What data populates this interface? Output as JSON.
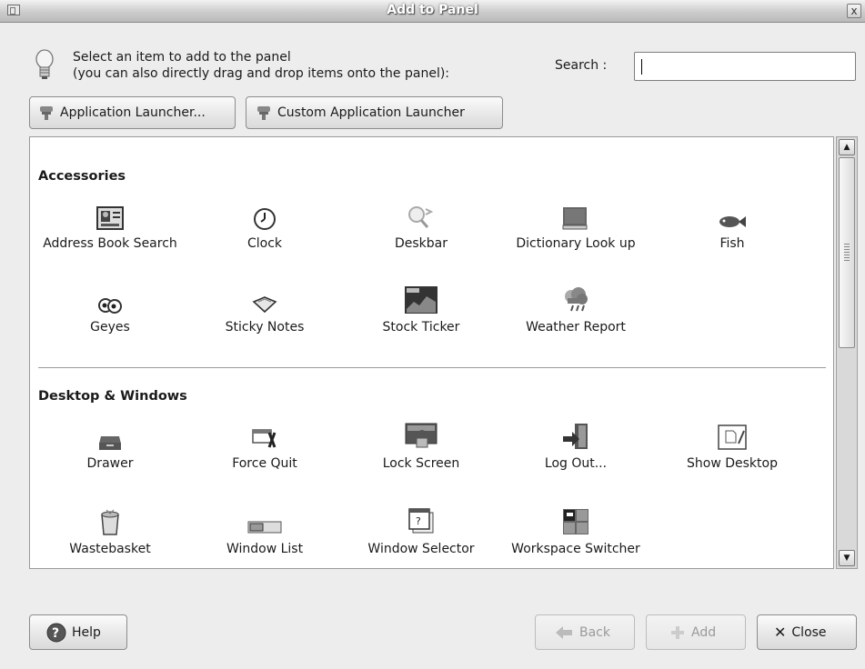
{
  "window": {
    "title": "Add to Panel",
    "close_glyph": "x"
  },
  "intro": {
    "line1": "Select an item to add to the panel",
    "line2": "(you can also directly drag and drop items onto the panel):"
  },
  "search": {
    "label": "Search :",
    "value": ""
  },
  "launchers": {
    "app_launcher": "Application Launcher...",
    "custom_launcher": "Custom Application Launcher"
  },
  "sections": [
    {
      "title": "Accessories",
      "items": [
        {
          "label": "Address Book Search",
          "icon": "address-book-icon"
        },
        {
          "label": "Clock",
          "icon": "clock-icon"
        },
        {
          "label": "Deskbar",
          "icon": "deskbar-icon"
        },
        {
          "label": "Dictionary Look up",
          "icon": "dictionary-icon"
        },
        {
          "label": "Fish",
          "icon": "fish-icon"
        },
        {
          "label": "Geyes",
          "icon": "geyes-icon"
        },
        {
          "label": "Sticky Notes",
          "icon": "sticky-notes-icon"
        },
        {
          "label": "Stock Ticker",
          "icon": "stock-ticker-icon"
        },
        {
          "label": "Weather Report",
          "icon": "weather-icon"
        }
      ]
    },
    {
      "title": "Desktop & Windows",
      "items": [
        {
          "label": "Drawer",
          "icon": "drawer-icon"
        },
        {
          "label": "Force Quit",
          "icon": "force-quit-icon"
        },
        {
          "label": "Lock Screen",
          "icon": "lock-screen-icon"
        },
        {
          "label": "Log Out...",
          "icon": "log-out-icon"
        },
        {
          "label": "Show Desktop",
          "icon": "show-desktop-icon"
        },
        {
          "label": "Wastebasket",
          "icon": "wastebasket-icon"
        },
        {
          "label": "Window List",
          "icon": "window-list-icon"
        },
        {
          "label": "Window Selector",
          "icon": "window-selector-icon"
        },
        {
          "label": "Workspace Switcher",
          "icon": "workspace-switcher-icon"
        }
      ]
    }
  ],
  "footer": {
    "help": "Help",
    "back": "Back",
    "add": "Add",
    "close": "Close"
  }
}
